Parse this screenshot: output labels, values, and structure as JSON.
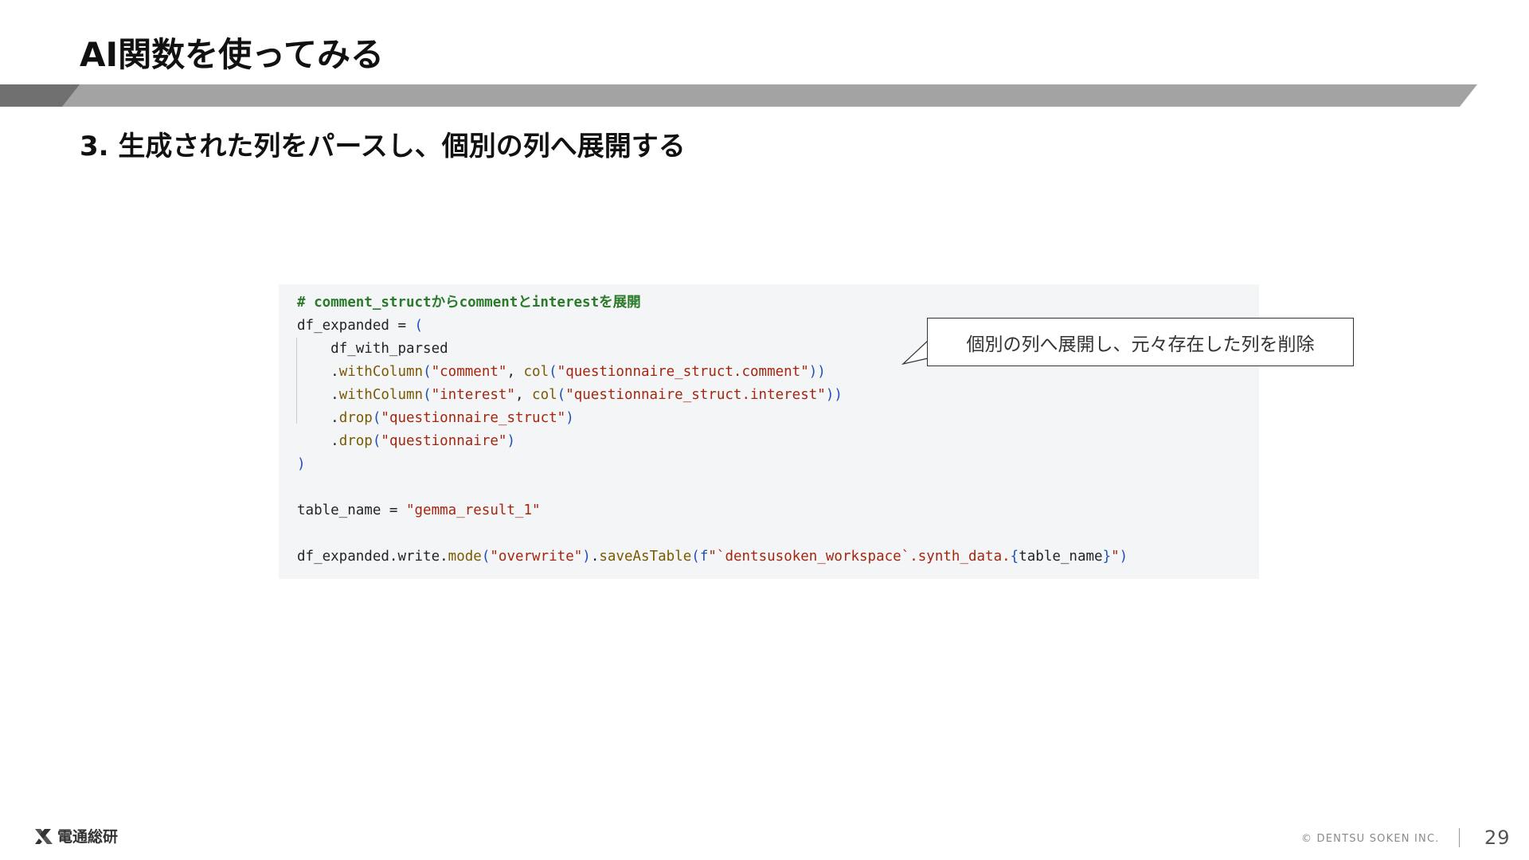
{
  "slide": {
    "title": "AI関数を使ってみる",
    "subtitle": "3. 生成された列をパースし、個別の列へ展開する",
    "accent_bar_colors": {
      "dark": "#707070",
      "light": "#a3a3a3"
    }
  },
  "code": {
    "comment": "# comment_structからcommentとinterestを展開",
    "line2_var": "df_expanded",
    "line2_op": " = ",
    "line2_open": "(",
    "line3": "df_with_parsed",
    "line4_dot": ".",
    "line4_method": "withColumn",
    "line4_open": "(",
    "line4_arg1": "\"comment\"",
    "line4_sep": ", ",
    "line4_fn": "col",
    "line4_open2": "(",
    "line4_arg2": "\"questionnaire_struct.comment\"",
    "line4_close": "))",
    "line5_dot": ".",
    "line5_method": "withColumn",
    "line5_open": "(",
    "line5_arg1": "\"interest\"",
    "line5_sep": ", ",
    "line5_fn": "col",
    "line5_open2": "(",
    "line5_arg2": "\"questionnaire_struct.interest\"",
    "line5_close": "))",
    "line6_dot": ".",
    "line6_method": "drop",
    "line6_open": "(",
    "line6_arg": "\"questionnaire_struct\"",
    "line6_close": ")",
    "line7_dot": ".",
    "line7_method": "drop",
    "line7_open": "(",
    "line7_arg": "\"questionnaire\"",
    "line7_close": ")",
    "line8_close": ")",
    "line10_var": "table_name",
    "line10_op": " = ",
    "line10_value": "\"gemma_result_1\"",
    "line12_obj": "df_expanded",
    "line12_chain1": ".write.",
    "line12_mode": "mode",
    "line12_open": "(",
    "line12_arg": "\"overwrite\"",
    "line12_close": ")",
    "line12_chain2": ".",
    "line12_save": "saveAsTable",
    "line12_open2": "(",
    "line12_fprefix": "f",
    "line12_fstr1": "\"`dentsusoken_workspace`.synth_data.",
    "line12_brace_open": "{",
    "line12_interp": "table_name",
    "line12_brace_close": "}",
    "line12_fstr2": "\"",
    "line12_close2": ")"
  },
  "callout": {
    "text": "個別の列へ展開し、元々存在した列を削除"
  },
  "footer": {
    "logo_text": "電通総研",
    "copyright": "© DENTSU SOKEN INC.",
    "page_number": "29"
  }
}
